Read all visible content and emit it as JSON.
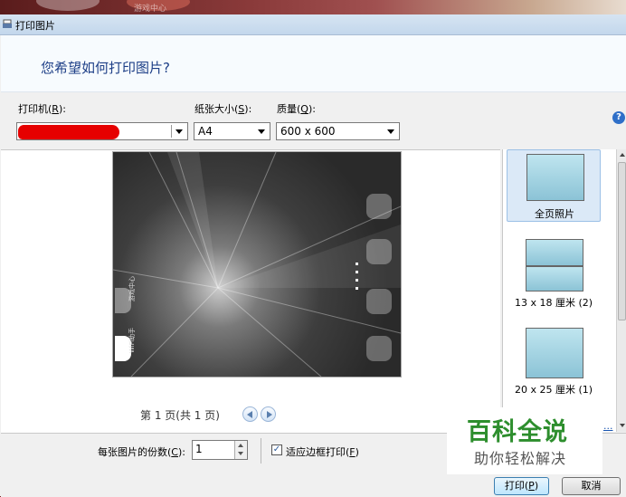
{
  "window": {
    "title": "打印图片"
  },
  "desktop": {
    "app_label": "游戏中心"
  },
  "header": {
    "title": "您希望如何打印图片?"
  },
  "printer": {
    "label": "打印机(R):",
    "label_pre": "打印机(",
    "hotkey": "R",
    "label_post": "):",
    "value": ""
  },
  "paper": {
    "label_pre": "纸张大小(",
    "hotkey": "S",
    "label_post": "):",
    "value": "A4"
  },
  "quality": {
    "label_pre": "质量(",
    "hotkey": "Q",
    "label_post": "):",
    "value": "600 x 600"
  },
  "help": {
    "glyph": "?"
  },
  "preview": {
    "page_text": "第 1 页(共 1 页)",
    "photo_labels": {
      "game_center": "游戏中心",
      "wifi_assistant": "WiFi助手"
    }
  },
  "layouts": [
    {
      "label": "全页照片",
      "selected": true
    },
    {
      "label": "13 x 18 厘米 (2)",
      "selected": false
    },
    {
      "label": "20 x 25 厘米 (1)",
      "selected": false
    }
  ],
  "bottom": {
    "copies_label_pre": "每张图片的份数(",
    "copies_hotkey": "C",
    "copies_label_post": "):",
    "copies_value": "1",
    "fit_label_pre": "适应边框打印(",
    "fit_hotkey": "F",
    "fit_label_post": ")",
    "fit_checked": true,
    "options_link": "...",
    "print_label_pre": "打印(",
    "print_hotkey": "P",
    "print_label_post": ")",
    "cancel_label": "取消"
  },
  "watermark": {
    "line1": "百科全说",
    "line2": "助你轻松解决"
  },
  "colors": {
    "accent": "#1e3f87",
    "redact": "#e60000",
    "watermark_green": "#2d8e2d"
  }
}
